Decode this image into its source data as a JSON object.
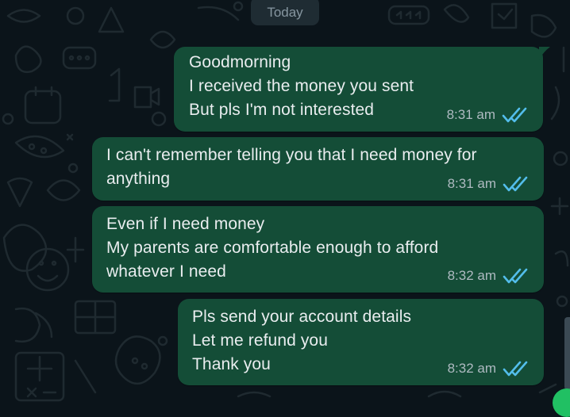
{
  "chat": {
    "date_label": "Today",
    "messages": [
      {
        "text": "Goodmorning\nI received the money you sent\nBut pls I'm not interested",
        "time": "8:31 am",
        "status_icon": "double-check-read-icon"
      },
      {
        "text": "I can't remember telling you that I need money for\nanything",
        "time": "8:31 am",
        "status_icon": "double-check-read-icon"
      },
      {
        "text": "Even if I need money\nMy parents are comfortable enough to afford\nwhatever I need",
        "time": "8:32 am",
        "status_icon": "double-check-read-icon"
      },
      {
        "text": "Pls send your account details\nLet me refund you\nThank you",
        "time": "8:32 am",
        "status_icon": "double-check-read-icon"
      }
    ]
  },
  "colors": {
    "background": "#0b141a",
    "outgoing_bubble": "#144d37",
    "read_tick": "#53bdeb",
    "time_text": "#aebac1",
    "message_text": "#e9edef"
  }
}
